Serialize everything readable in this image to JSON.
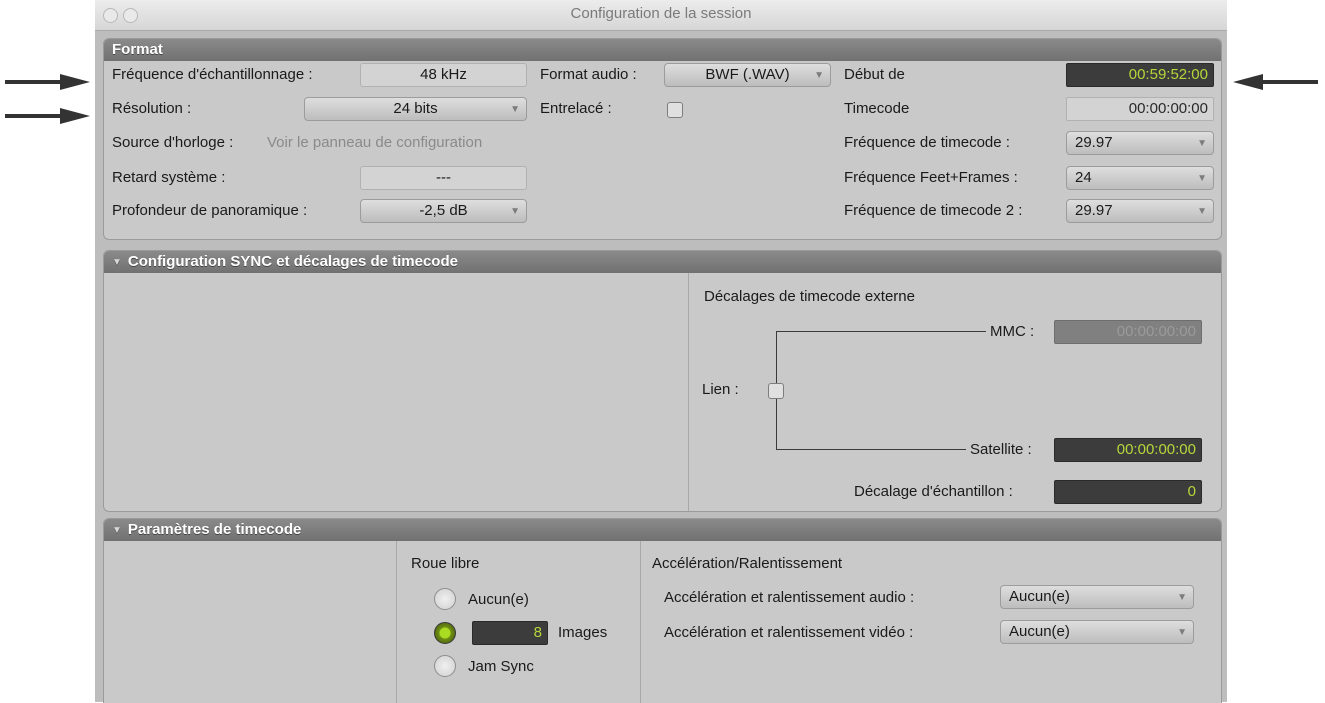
{
  "window": {
    "title": "Configuration de la session"
  },
  "format": {
    "header": "Format",
    "sample_rate_label": "Fréquence d'échantillonnage :",
    "sample_rate_value": "48 kHz",
    "audio_format_label": "Format audio :",
    "audio_format_value": "BWF (.WAV)",
    "start_label": "Début de",
    "start_value": "00:59:52:00",
    "resolution_label": "Résolution :",
    "resolution_value": "24 bits",
    "interleaved_label": "Entrelacé :",
    "timecode_label": "Timecode",
    "timecode_value": "00:00:00:00",
    "clock_source_label": "Source d'horloge :",
    "clock_source_value": "Voir le panneau de configuration",
    "timecode_rate_label": "Fréquence de timecode :",
    "timecode_rate_value": "29.97",
    "system_delay_label": "Retard système :",
    "system_delay_value": "---",
    "feet_frames_label": "Fréquence Feet+Frames :",
    "feet_frames_value": "24",
    "pan_depth_label": "Profondeur de panoramique :",
    "pan_depth_value": "-2,5 dB",
    "timecode_rate2_label": "Fréquence de timecode 2 :",
    "timecode_rate2_value": "29.97"
  },
  "sync": {
    "header": "Configuration SYNC et décalages de timecode",
    "external_offsets_label": "Décalages de timecode externe",
    "mmc_label": "MMC :",
    "mmc_value": "00:00:00:00",
    "link_label": "Lien :",
    "satellite_label": "Satellite :",
    "satellite_value": "00:00:00:00",
    "sample_offset_label": "Décalage d'échantillon :",
    "sample_offset_value": "0"
  },
  "timecode_params": {
    "header": "Paramètres de timecode",
    "freewheel_label": "Roue libre",
    "option_none": "Aucun(e)",
    "frames_value": "8",
    "frames_label": "Images",
    "option_jamsync": "Jam Sync",
    "pullup_label": "Accélération/Ralentissement",
    "audio_pull_label": "Accélération et ralentissement audio :",
    "audio_pull_value": "Aucun(e)",
    "video_pull_label": "Accélération et ralentissement vidéo :",
    "video_pull_value": "Aucun(e)"
  },
  "colors": {
    "timecode_green": "#b5d73a",
    "panel_header": "#7a7a7a",
    "panel_body": "#c9c9c9"
  }
}
